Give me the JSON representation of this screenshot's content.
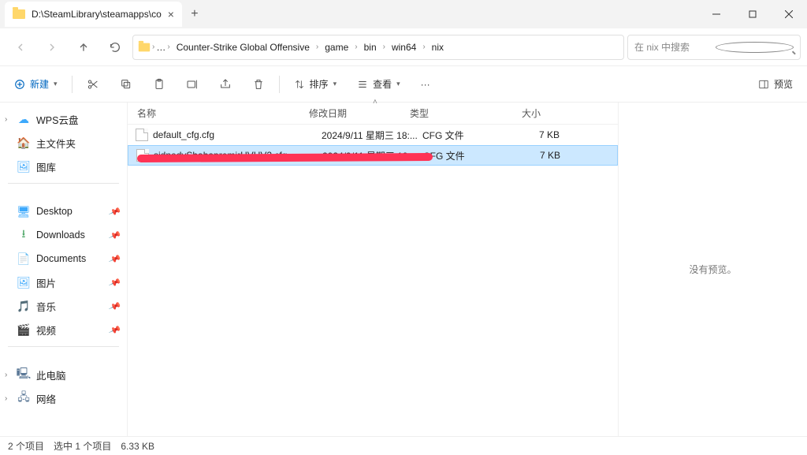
{
  "window": {
    "tab_title": "D:\\SteamLibrary\\steamapps\\co"
  },
  "breadcrumb": {
    "items": [
      "Counter-Strike Global Offensive",
      "game",
      "bin",
      "win64",
      "nix"
    ]
  },
  "search": {
    "placeholder": "在 nix 中搜索"
  },
  "cmd": {
    "new": "新建",
    "sort": "排序",
    "view": "查看",
    "preview": "预览"
  },
  "sidebar": {
    "wps": "WPS云盘",
    "home": "主文件夹",
    "gallery": "图库",
    "desktop": "Desktop",
    "downloads": "Downloads",
    "documents": "Documents",
    "pictures": "图片",
    "music": "音乐",
    "videos": "视频",
    "thispc": "此电脑",
    "network": "网络"
  },
  "columns": {
    "name": "名称",
    "date": "修改日期",
    "type": "类型",
    "size": "大小"
  },
  "rows": [
    {
      "name": "default_cfg.cfg",
      "date": "2024/9/11 星期三 18:...",
      "type": "CFG 文件",
      "size": "7 KB"
    },
    {
      "name": "sidnedySbabapremirHVHV2.cfg",
      "date": "2024/9/11 星期三 19:...",
      "type": "CFG 文件",
      "size": "7 KB"
    }
  ],
  "preview": {
    "empty": "没有预览。"
  },
  "status": {
    "count": "2 个项目",
    "selected": "选中 1 个项目",
    "size": "6.33 KB"
  }
}
